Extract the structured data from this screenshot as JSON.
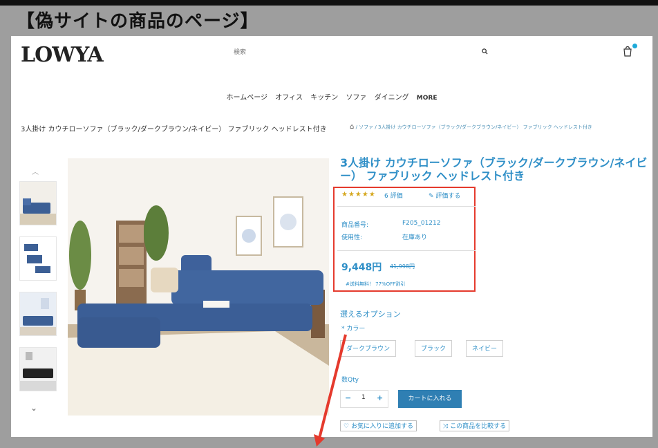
{
  "caption": "【偽サイトの商品のページ】",
  "header": {
    "logo": "LOWYA",
    "search_placeholder": "検索",
    "search_icon": "search-icon",
    "cart_icon": "cart-icon"
  },
  "nav": {
    "items": [
      "ホームページ",
      "オフィス",
      "キッチン",
      "ソファ",
      "ダイニング",
      "MORE"
    ]
  },
  "breadcrumb": {
    "page_title": "3人掛け カウチローソファ（ブラック/ダークブラウン/ネイビー） ファブリック ヘッドレスト付き",
    "path": "/ ソファ / 3人掛け カウチローソファ（ブラック/ダークブラウン/ネイビー） ファブリック ヘッドレスト付き"
  },
  "product": {
    "title": "3人掛け カウチローソファ（ブラック/ダークブラウン/ネイビー） ファブリック ヘッドレスト付き",
    "stars": "★★★★★",
    "rating_count": "6 評価",
    "write_review": "評価する",
    "sku_label": "商品番号:",
    "sku_value": "F205_01212",
    "stock_label": "使用性:",
    "stock_value": "在庫あり",
    "price": "9,448円",
    "old_price": "41,998円",
    "shipping_note": "#送料無料！ 77%OFF割引"
  },
  "options": {
    "heading": "選えるオプション",
    "color_label": "* カラー",
    "colors": [
      "ダークブラウン",
      "ブラック",
      "ネイビー"
    ],
    "qty_label": "数Qty",
    "qty_minus": "−",
    "qty_value": "1",
    "qty_plus": "+",
    "add_to_cart": "カートに入れる",
    "favorite": "お気に入りに追加する",
    "compare": "この商品を比較する"
  },
  "colors": {
    "accent": "#2f8fc7",
    "highlight_box": "#e53a2d",
    "cart_button": "#2f7fb3"
  }
}
